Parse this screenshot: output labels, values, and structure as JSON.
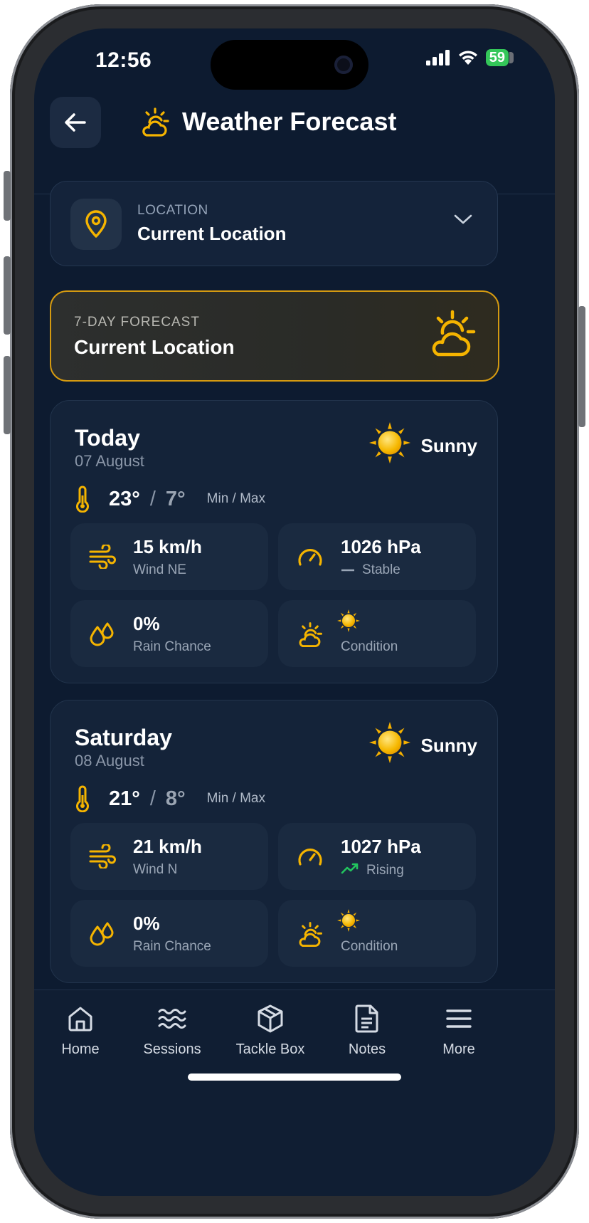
{
  "status": {
    "time": "12:56",
    "battery": "59"
  },
  "header": {
    "back_icon": "arrow-left-icon",
    "title": "Weather Forecast"
  },
  "location": {
    "label": "LOCATION",
    "value": "Current Location"
  },
  "banner": {
    "label": "7-DAY FORECAST",
    "value": "Current Location"
  },
  "days": [
    {
      "name": "Today",
      "date": "07 August",
      "condition": "Sunny",
      "temp_a": "23°",
      "temp_b": "7°",
      "temp_label": "Min / Max",
      "wind_value": "15 km/h",
      "wind_label": "Wind NE",
      "pressure_value": "1026 hPa",
      "pressure_trend": "Stable",
      "rain_value": "0%",
      "rain_label": "Rain Chance",
      "condition_label": "Condition"
    },
    {
      "name": "Saturday",
      "date": "08 August",
      "condition": "Sunny",
      "temp_a": "21°",
      "temp_b": "8°",
      "temp_label": "Min / Max",
      "wind_value": "21 km/h",
      "wind_label": "Wind N",
      "pressure_value": "1027 hPa",
      "pressure_trend": "Rising",
      "rain_value": "0%",
      "rain_label": "Rain Chance",
      "condition_label": "Condition"
    }
  ],
  "nav": {
    "home": "Home",
    "sessions": "Sessions",
    "tackle_box": "Tackle Box",
    "notes": "Notes",
    "more": "More"
  },
  "colors": {
    "accent": "#f5b400",
    "background": "#0d1b30",
    "rising": "#22c55e"
  }
}
